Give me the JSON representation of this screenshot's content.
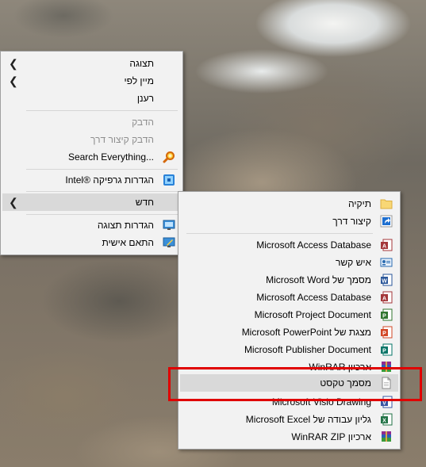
{
  "context_menu": {
    "items": [
      {
        "label": "תצוגה",
        "arrow": true
      },
      {
        "label": "מיין לפי",
        "arrow": true
      },
      {
        "label": "רענן"
      },
      {
        "label": "הדבק",
        "disabled": true
      },
      {
        "label": "הדבק קיצור דרך",
        "disabled": true
      },
      {
        "label": "Search Everything...",
        "icon": "search-everything-icon"
      },
      {
        "label": "הגדרות גרפיקה ®Intel",
        "icon": "intel-graphics-icon"
      },
      {
        "label": "חדש",
        "arrow": true
      },
      {
        "label": "הגדרות תצוגה",
        "icon": "display-settings-icon"
      },
      {
        "label": "התאם אישית",
        "icon": "personalize-icon"
      }
    ]
  },
  "new_submenu": {
    "items": [
      {
        "label": "תיקיה",
        "icon": "folder-icon"
      },
      {
        "label": "קיצור דרך",
        "icon": "shortcut-icon"
      },
      {
        "label": "Microsoft Access Database",
        "icon": "access-icon"
      },
      {
        "label": "איש קשר",
        "icon": "contact-icon"
      },
      {
        "label": "מסמך של Microsoft Word",
        "icon": "word-icon"
      },
      {
        "label": "Microsoft Access Database",
        "icon": "access-icon"
      },
      {
        "label": "Microsoft Project Document",
        "icon": "project-icon"
      },
      {
        "label": "מצגת של Microsoft PowerPoint",
        "icon": "powerpoint-icon"
      },
      {
        "label": "Microsoft Publisher Document",
        "icon": "publisher-icon"
      },
      {
        "label": "ארכיון WinRAR",
        "icon": "winrar-icon"
      },
      {
        "label": "מסמך טקסט",
        "icon": "text-document-icon"
      },
      {
        "label": "Microsoft Visio Drawing",
        "icon": "visio-icon"
      },
      {
        "label": "גליון עבודה של Microsoft Excel",
        "icon": "excel-icon"
      },
      {
        "label": "ארכיון WinRAR ZIP",
        "icon": "winrar-zip-icon"
      }
    ]
  },
  "colors": {
    "highlight_border": "#e00000",
    "menu_background": "#f2f2f2",
    "hover_background": "#d9d9d9"
  }
}
